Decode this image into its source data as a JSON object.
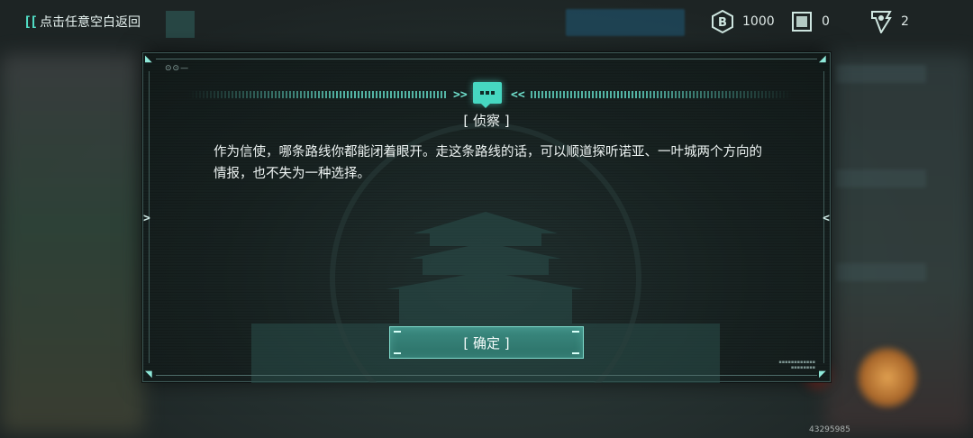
{
  "top_bar": {
    "back_label": "点击任意空白返回",
    "resources": [
      {
        "icon": "currency-b-icon",
        "value": "1000"
      },
      {
        "icon": "card-icon",
        "value": "0"
      },
      {
        "icon": "badge-icon",
        "value": "2"
      }
    ]
  },
  "dialog": {
    "title": "[ 侦察 ]",
    "body": "作为信使，哪条路线你都能闭着眼开。走这条路线的话，可以顺道探听诺亚、一叶城两个方向的情报，也不失为一种选择。",
    "confirm_label": "[ 确定 ]"
  },
  "footer": {
    "uid": "43295985"
  },
  "colors": {
    "accent": "#46d7c1",
    "button": "#2f7a70",
    "panel": "#172120"
  }
}
